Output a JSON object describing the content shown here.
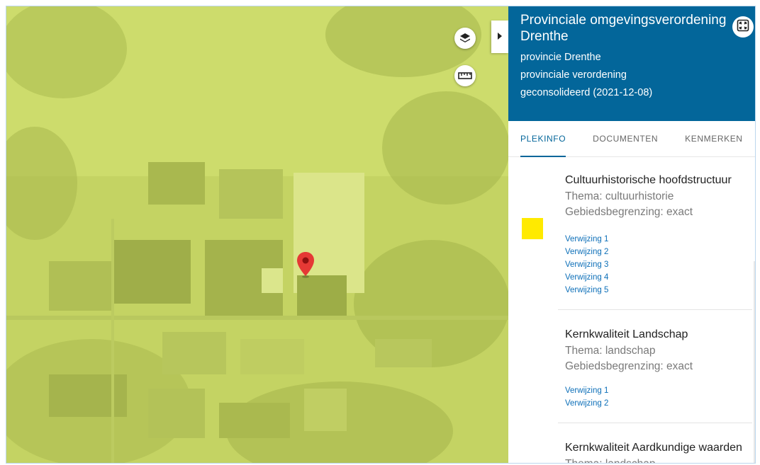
{
  "map": {
    "layers_button_icon": "layers-icon",
    "measure_button_icon": "ruler-icon",
    "toggle_icon": "triangle-right-icon",
    "marker_icon": "map-pin-icon",
    "marker_color": "#e53935",
    "overlay_color": "#d4e063"
  },
  "panel": {
    "title": "Provinciale omgevingsverordening Drenthe",
    "authority": "provincie Drenthe",
    "doc_type": "provinciale verordening",
    "status": "geconsolideerd (2021-12-08)",
    "fullscreen_icon": "fullscreen-icon",
    "header_color": "#03669a"
  },
  "tabs": [
    {
      "label": "PLEKINFO",
      "active": true
    },
    {
      "label": "DOCUMENTEN",
      "active": false
    },
    {
      "label": "KENMERKEN",
      "active": false
    }
  ],
  "items": [
    {
      "title": "Cultuurhistorische hoofdstructuur",
      "theme": "Thema: cultuurhistorie",
      "boundary": "Gebiedsbegrenzing: exact",
      "swatch_color": "#ffea00",
      "refs": [
        "Verwijzing 1",
        "Verwijzing 2",
        "Verwijzing 3",
        "Verwijzing 4",
        "Verwijzing 5"
      ]
    },
    {
      "title": "Kernkwaliteit Landschap",
      "theme": "Thema: landschap",
      "boundary": "Gebiedsbegrenzing: exact",
      "refs": [
        "Verwijzing 1",
        "Verwijzing 2"
      ]
    },
    {
      "title": "Kernkwaliteit Aardkundige waarden",
      "theme": "Thema: landschap"
    }
  ]
}
